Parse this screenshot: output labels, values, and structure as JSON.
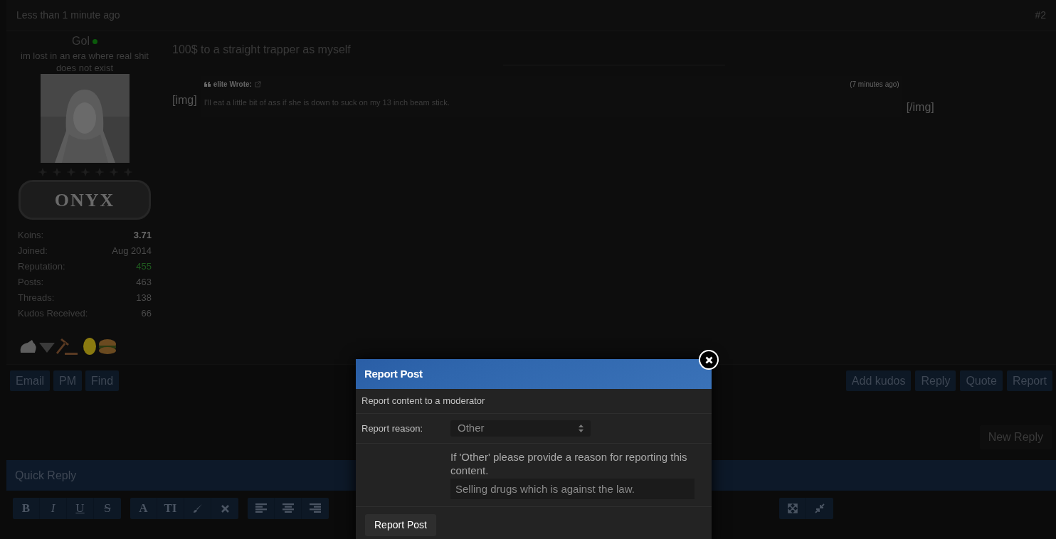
{
  "post": {
    "time": "Less than 1 minute ago",
    "number": "#2"
  },
  "author": {
    "name": "Gol",
    "online": true,
    "usertitle": "im lost in an era where real shit does not exist",
    "rank": "ONYX",
    "stats": [
      {
        "label": "Koins:",
        "value": "3.71",
        "kind": "bold"
      },
      {
        "label": "Joined:",
        "value": "Aug 2014",
        "kind": "plain"
      },
      {
        "label": "Reputation:",
        "value": "455",
        "kind": "positive"
      },
      {
        "label": "Posts:",
        "value": "463",
        "kind": "plain"
      },
      {
        "label": "Threads:",
        "value": "138",
        "kind": "plain"
      },
      {
        "label": "Kudos Received:",
        "value": "66",
        "kind": "plain"
      }
    ]
  },
  "message": {
    "text": "100$ to a straight trapper as myself",
    "img_open": "[img]",
    "img_close": "[/img]",
    "quote": {
      "author": "elite Wrote:",
      "time": "(7 minutes ago)",
      "text": "I'll eat a little bit of ass if she is down to suck on my 13 inch beam stick."
    }
  },
  "left_buttons": [
    "Email",
    "PM",
    "Find"
  ],
  "right_buttons": [
    "Add kudos",
    "Reply",
    "Quote",
    "Report"
  ],
  "new_reply": "New Reply",
  "quick_reply": {
    "title": "Quick Reply",
    "format_buttons": [
      {
        "label": "B",
        "kind": "bold"
      },
      {
        "label": "I",
        "kind": "italic"
      },
      {
        "label": "U",
        "kind": "underline"
      },
      {
        "label": "S",
        "kind": "strike"
      }
    ],
    "font_buttons": [
      {
        "label": "A",
        "kind": "serif"
      },
      {
        "label": "TI",
        "kind": "serif"
      }
    ]
  },
  "dialog": {
    "title": "Report Post",
    "subtitle": "Report content to a moderator",
    "reason_label": "Report reason:",
    "reason_value": "Other",
    "hint": "If 'Other' please provide a reason for reporting this content.",
    "reason_text": "Selling drugs which is against the law.",
    "submit": "Report Post"
  }
}
